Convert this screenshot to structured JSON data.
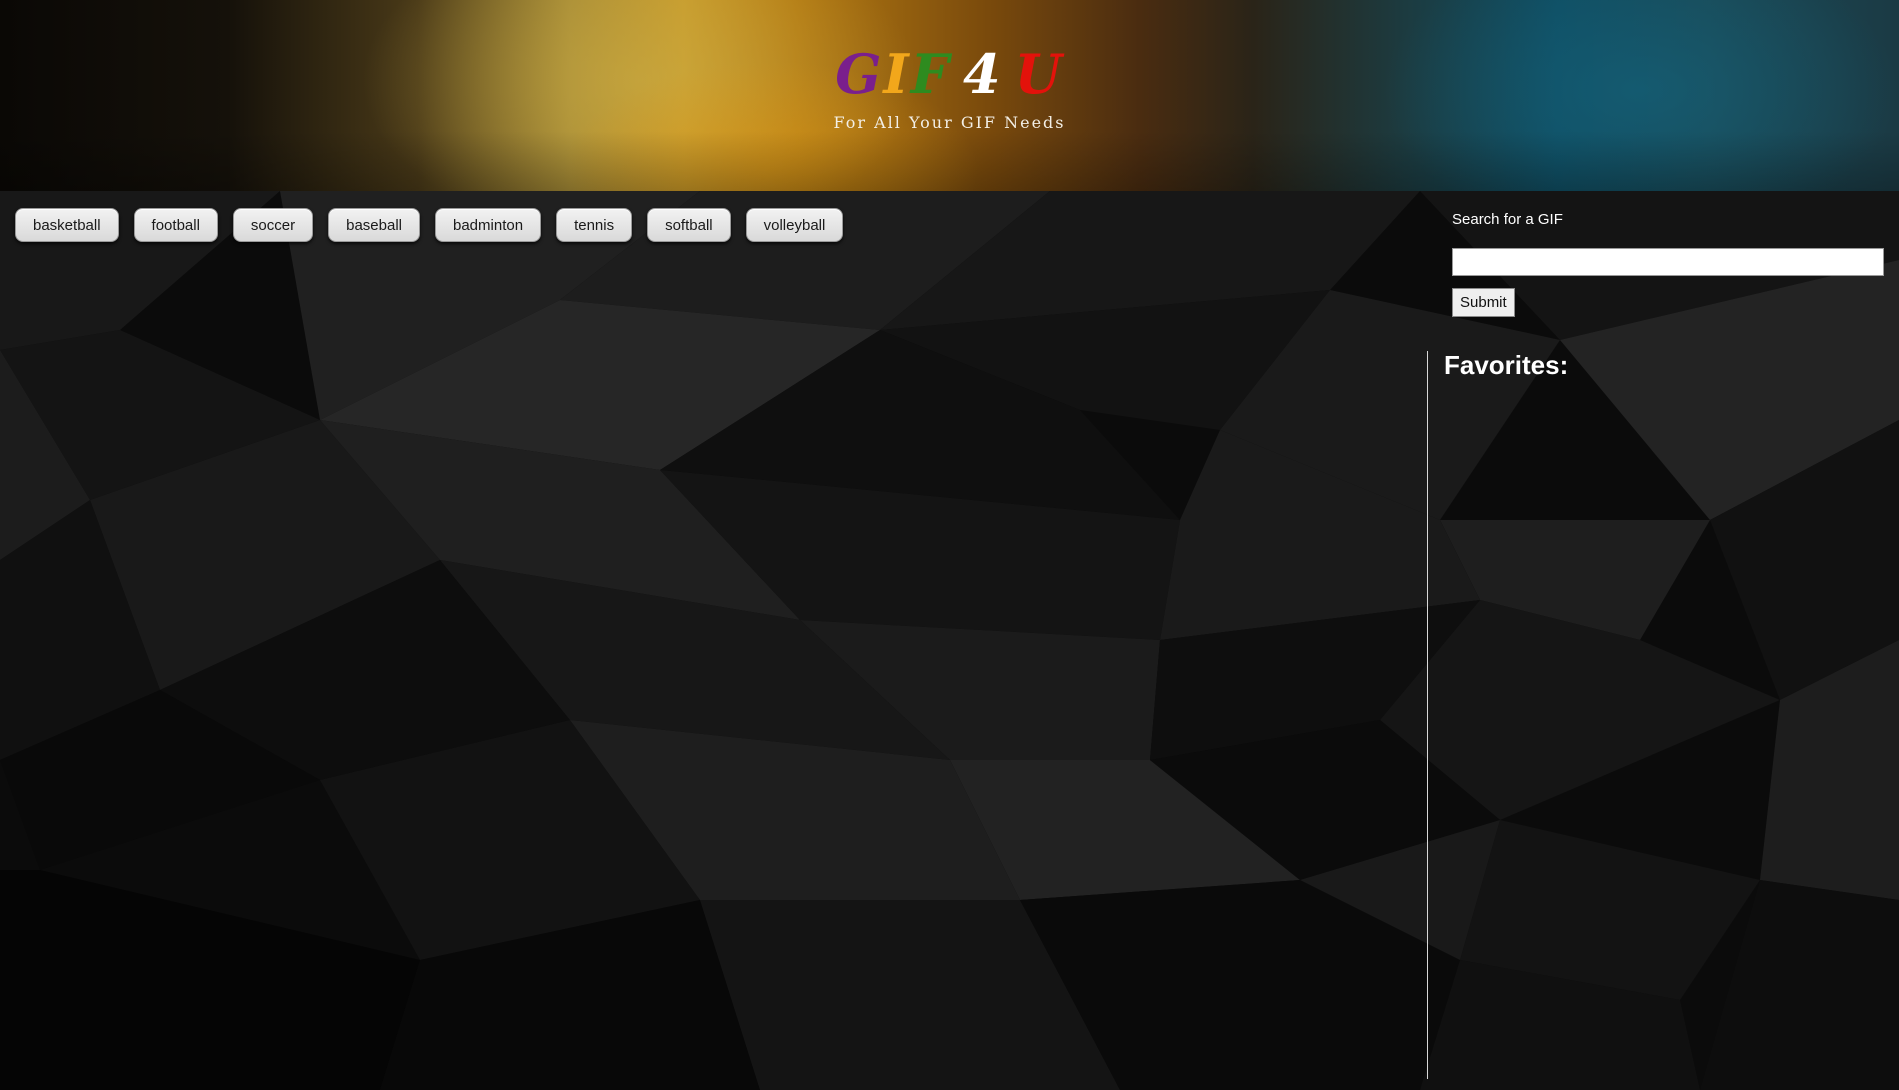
{
  "header": {
    "logo": [
      {
        "text": "G",
        "color": "#7a1f8c"
      },
      {
        "text": "I",
        "color": "#f2a71b"
      },
      {
        "text": "F",
        "color": "#2e8b1f"
      },
      {
        "text": "4",
        "color": "#ffffff"
      },
      {
        "text": "U",
        "color": "#e3120b"
      }
    ],
    "tagline": "For All Your GIF Needs"
  },
  "categories": [
    "basketball",
    "football",
    "soccer",
    "baseball",
    "badminton",
    "tennis",
    "softball",
    "volleyball"
  ],
  "search": {
    "label": "Search for a GIF",
    "value": "",
    "submit_label": "Submit"
  },
  "favorites": {
    "title": "Favorites:"
  }
}
